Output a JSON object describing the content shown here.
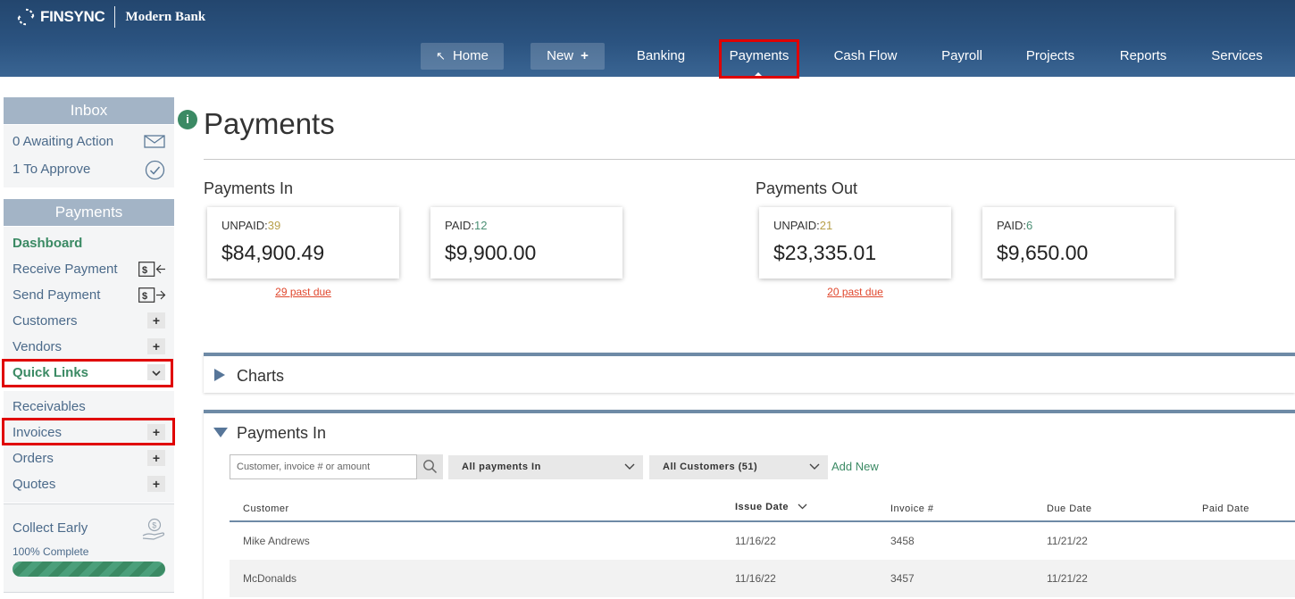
{
  "header": {
    "logo_text": "FINSYNC",
    "bank_name": "Modern Bank",
    "nav": {
      "home": "Home",
      "new": "New",
      "banking": "Banking",
      "payments": "Payments",
      "cashflow": "Cash Flow",
      "payroll": "Payroll",
      "projects": "Projects",
      "reports": "Reports",
      "services": "Services"
    }
  },
  "sidebar": {
    "inbox_title": "Inbox",
    "awaiting": "0 Awaiting Action",
    "to_approve": "1 To Approve",
    "payments_title": "Payments",
    "dashboard": "Dashboard",
    "receive_payment": "Receive Payment",
    "send_payment": "Send Payment",
    "customers": "Customers",
    "vendors": "Vendors",
    "quick_links": "Quick Links",
    "receivables": "Receivables",
    "invoices": "Invoices",
    "orders": "Orders",
    "quotes": "Quotes",
    "collect_early": "Collect Early",
    "collect_progress_label": "100% Complete",
    "collect_progress": 100
  },
  "main": {
    "title": "Payments",
    "payments_in": {
      "label": "Payments In",
      "unpaid_label": "UNPAID:",
      "unpaid_count": "39",
      "unpaid_amount": "$84,900.49",
      "paid_label": "PAID:",
      "paid_count": "12",
      "paid_amount": "$9,900.00",
      "past_due": "29 past due"
    },
    "payments_out": {
      "label": "Payments Out",
      "unpaid_label": "UNPAID:",
      "unpaid_count": "21",
      "unpaid_amount": "$23,335.01",
      "paid_label": "PAID:",
      "paid_count": "6",
      "paid_amount": "$9,650.00",
      "past_due": "20 past due"
    },
    "charts_panel": "Charts",
    "payments_in_panel": "Payments In",
    "search_placeholder": "Customer, invoice # or amount",
    "filter_payments": "All payments In",
    "filter_customers": "All Customers (51)",
    "add_new": "Add New",
    "columns": {
      "customer": "Customer",
      "issue_date": "Issue Date",
      "invoice": "Invoice #",
      "due_date": "Due Date",
      "paid_date": "Paid Date"
    },
    "rows": [
      {
        "customer": "Mike Andrews",
        "issue_date": "11/16/22",
        "invoice": "3458",
        "due_date": "11/21/22",
        "paid_date": ""
      },
      {
        "customer": "McDonalds",
        "issue_date": "11/16/22",
        "invoice": "3457",
        "due_date": "11/21/22",
        "paid_date": ""
      }
    ]
  },
  "colors": {
    "header": "#2b5380",
    "accent_green": "#3b8a64",
    "highlight_red": "#e00000",
    "past_due": "#e0472d"
  }
}
